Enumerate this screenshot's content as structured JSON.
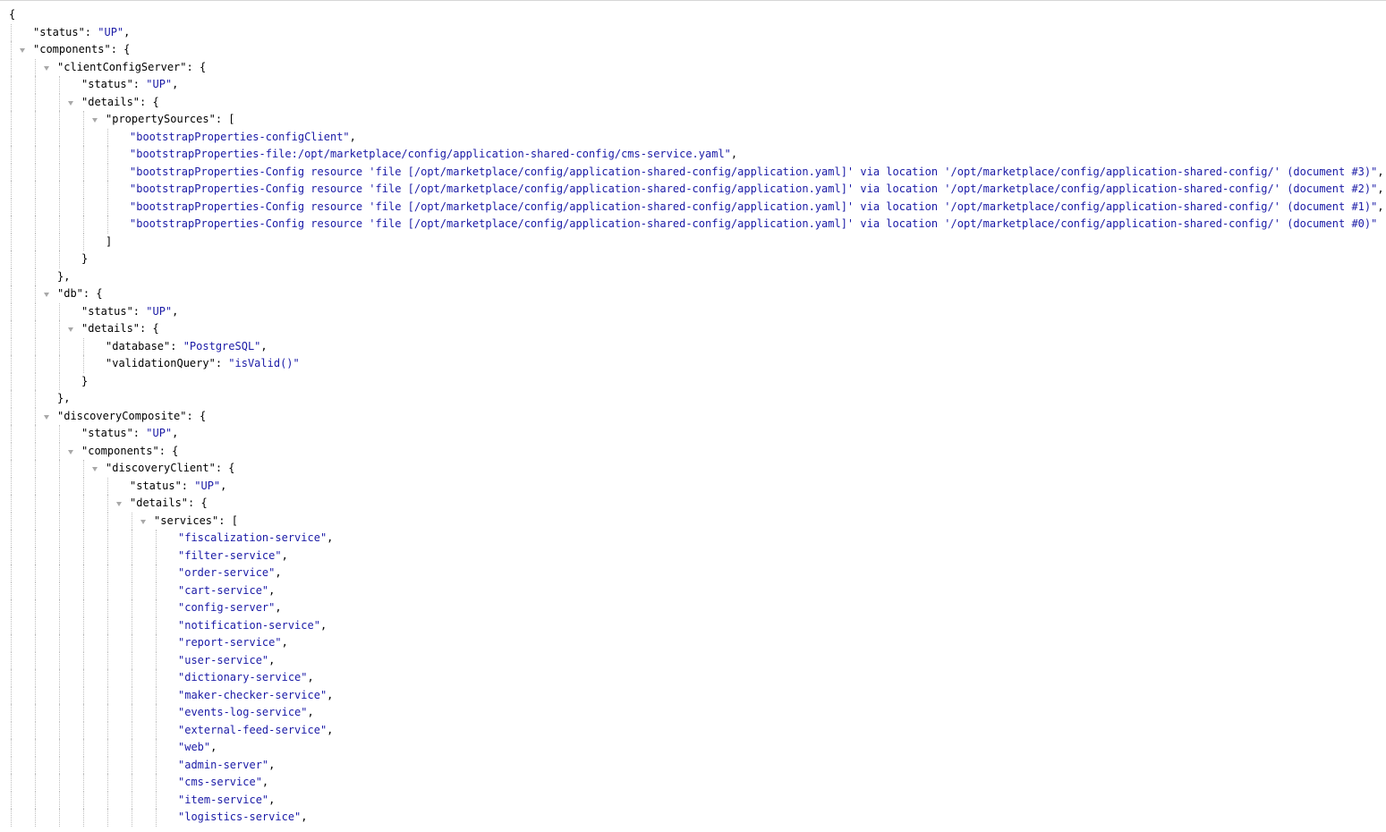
{
  "document": {
    "lines": [
      {
        "depth": 0,
        "toggle": false,
        "parts": [
          {
            "t": "{",
            "c": "punct"
          }
        ]
      },
      {
        "depth": 1,
        "toggle": false,
        "parts": [
          {
            "t": "\"status\"",
            "c": "key"
          },
          {
            "t": ": ",
            "c": "punct"
          },
          {
            "t": "\"UP\"",
            "c": "str"
          },
          {
            "t": ",",
            "c": "punct"
          }
        ]
      },
      {
        "depth": 1,
        "toggle": true,
        "parts": [
          {
            "t": "\"components\"",
            "c": "key"
          },
          {
            "t": ": {",
            "c": "punct"
          }
        ]
      },
      {
        "depth": 2,
        "toggle": true,
        "parts": [
          {
            "t": "\"clientConfigServer\"",
            "c": "key"
          },
          {
            "t": ": {",
            "c": "punct"
          }
        ]
      },
      {
        "depth": 3,
        "toggle": false,
        "parts": [
          {
            "t": "\"status\"",
            "c": "key"
          },
          {
            "t": ": ",
            "c": "punct"
          },
          {
            "t": "\"UP\"",
            "c": "str"
          },
          {
            "t": ",",
            "c": "punct"
          }
        ]
      },
      {
        "depth": 3,
        "toggle": true,
        "parts": [
          {
            "t": "\"details\"",
            "c": "key"
          },
          {
            "t": ": {",
            "c": "punct"
          }
        ]
      },
      {
        "depth": 4,
        "toggle": true,
        "parts": [
          {
            "t": "\"propertySources\"",
            "c": "key"
          },
          {
            "t": ": [",
            "c": "punct"
          }
        ]
      },
      {
        "depth": 5,
        "toggle": false,
        "parts": [
          {
            "t": "\"bootstrapProperties-configClient\"",
            "c": "str"
          },
          {
            "t": ",",
            "c": "punct"
          }
        ]
      },
      {
        "depth": 5,
        "toggle": false,
        "parts": [
          {
            "t": "\"bootstrapProperties-file:/opt/marketplace/config/application-shared-config/cms-service.yaml\"",
            "c": "str"
          },
          {
            "t": ",",
            "c": "punct"
          }
        ]
      },
      {
        "depth": 5,
        "toggle": false,
        "parts": [
          {
            "t": "\"bootstrapProperties-Config resource 'file [/opt/marketplace/config/application-shared-config/application.yaml]' via location '/opt/marketplace/config/application-shared-config/' (document #3)\"",
            "c": "str"
          },
          {
            "t": ",",
            "c": "punct"
          }
        ]
      },
      {
        "depth": 5,
        "toggle": false,
        "parts": [
          {
            "t": "\"bootstrapProperties-Config resource 'file [/opt/marketplace/config/application-shared-config/application.yaml]' via location '/opt/marketplace/config/application-shared-config/' (document #2)\"",
            "c": "str"
          },
          {
            "t": ",",
            "c": "punct"
          }
        ]
      },
      {
        "depth": 5,
        "toggle": false,
        "parts": [
          {
            "t": "\"bootstrapProperties-Config resource 'file [/opt/marketplace/config/application-shared-config/application.yaml]' via location '/opt/marketplace/config/application-shared-config/' (document #1)\"",
            "c": "str"
          },
          {
            "t": ",",
            "c": "punct"
          }
        ]
      },
      {
        "depth": 5,
        "toggle": false,
        "parts": [
          {
            "t": "\"bootstrapProperties-Config resource 'file [/opt/marketplace/config/application-shared-config/application.yaml]' via location '/opt/marketplace/config/application-shared-config/' (document #0)\"",
            "c": "str"
          }
        ]
      },
      {
        "depth": 4,
        "toggle": false,
        "parts": [
          {
            "t": "]",
            "c": "punct"
          }
        ]
      },
      {
        "depth": 3,
        "toggle": false,
        "parts": [
          {
            "t": "}",
            "c": "punct"
          }
        ]
      },
      {
        "depth": 2,
        "toggle": false,
        "parts": [
          {
            "t": "},",
            "c": "punct"
          }
        ]
      },
      {
        "depth": 2,
        "toggle": true,
        "parts": [
          {
            "t": "\"db\"",
            "c": "key"
          },
          {
            "t": ": {",
            "c": "punct"
          }
        ]
      },
      {
        "depth": 3,
        "toggle": false,
        "parts": [
          {
            "t": "\"status\"",
            "c": "key"
          },
          {
            "t": ": ",
            "c": "punct"
          },
          {
            "t": "\"UP\"",
            "c": "str"
          },
          {
            "t": ",",
            "c": "punct"
          }
        ]
      },
      {
        "depth": 3,
        "toggle": true,
        "parts": [
          {
            "t": "\"details\"",
            "c": "key"
          },
          {
            "t": ": {",
            "c": "punct"
          }
        ]
      },
      {
        "depth": 4,
        "toggle": false,
        "parts": [
          {
            "t": "\"database\"",
            "c": "key"
          },
          {
            "t": ": ",
            "c": "punct"
          },
          {
            "t": "\"PostgreSQL\"",
            "c": "str"
          },
          {
            "t": ",",
            "c": "punct"
          }
        ]
      },
      {
        "depth": 4,
        "toggle": false,
        "parts": [
          {
            "t": "\"validationQuery\"",
            "c": "key"
          },
          {
            "t": ": ",
            "c": "punct"
          },
          {
            "t": "\"isValid()\"",
            "c": "str"
          }
        ]
      },
      {
        "depth": 3,
        "toggle": false,
        "parts": [
          {
            "t": "}",
            "c": "punct"
          }
        ]
      },
      {
        "depth": 2,
        "toggle": false,
        "parts": [
          {
            "t": "},",
            "c": "punct"
          }
        ]
      },
      {
        "depth": 2,
        "toggle": true,
        "parts": [
          {
            "t": "\"discoveryComposite\"",
            "c": "key"
          },
          {
            "t": ": {",
            "c": "punct"
          }
        ]
      },
      {
        "depth": 3,
        "toggle": false,
        "parts": [
          {
            "t": "\"status\"",
            "c": "key"
          },
          {
            "t": ": ",
            "c": "punct"
          },
          {
            "t": "\"UP\"",
            "c": "str"
          },
          {
            "t": ",",
            "c": "punct"
          }
        ]
      },
      {
        "depth": 3,
        "toggle": true,
        "parts": [
          {
            "t": "\"components\"",
            "c": "key"
          },
          {
            "t": ": {",
            "c": "punct"
          }
        ]
      },
      {
        "depth": 4,
        "toggle": true,
        "parts": [
          {
            "t": "\"discoveryClient\"",
            "c": "key"
          },
          {
            "t": ": {",
            "c": "punct"
          }
        ]
      },
      {
        "depth": 5,
        "toggle": false,
        "parts": [
          {
            "t": "\"status\"",
            "c": "key"
          },
          {
            "t": ": ",
            "c": "punct"
          },
          {
            "t": "\"UP\"",
            "c": "str"
          },
          {
            "t": ",",
            "c": "punct"
          }
        ]
      },
      {
        "depth": 5,
        "toggle": true,
        "parts": [
          {
            "t": "\"details\"",
            "c": "key"
          },
          {
            "t": ": {",
            "c": "punct"
          }
        ]
      },
      {
        "depth": 6,
        "toggle": true,
        "parts": [
          {
            "t": "\"services\"",
            "c": "key"
          },
          {
            "t": ": [",
            "c": "punct"
          }
        ]
      },
      {
        "depth": 7,
        "toggle": false,
        "parts": [
          {
            "t": "\"fiscalization-service\"",
            "c": "str"
          },
          {
            "t": ",",
            "c": "punct"
          }
        ]
      },
      {
        "depth": 7,
        "toggle": false,
        "parts": [
          {
            "t": "\"filter-service\"",
            "c": "str"
          },
          {
            "t": ",",
            "c": "punct"
          }
        ]
      },
      {
        "depth": 7,
        "toggle": false,
        "parts": [
          {
            "t": "\"order-service\"",
            "c": "str"
          },
          {
            "t": ",",
            "c": "punct"
          }
        ]
      },
      {
        "depth": 7,
        "toggle": false,
        "parts": [
          {
            "t": "\"cart-service\"",
            "c": "str"
          },
          {
            "t": ",",
            "c": "punct"
          }
        ]
      },
      {
        "depth": 7,
        "toggle": false,
        "parts": [
          {
            "t": "\"config-server\"",
            "c": "str"
          },
          {
            "t": ",",
            "c": "punct"
          }
        ]
      },
      {
        "depth": 7,
        "toggle": false,
        "parts": [
          {
            "t": "\"notification-service\"",
            "c": "str"
          },
          {
            "t": ",",
            "c": "punct"
          }
        ]
      },
      {
        "depth": 7,
        "toggle": false,
        "parts": [
          {
            "t": "\"report-service\"",
            "c": "str"
          },
          {
            "t": ",",
            "c": "punct"
          }
        ]
      },
      {
        "depth": 7,
        "toggle": false,
        "parts": [
          {
            "t": "\"user-service\"",
            "c": "str"
          },
          {
            "t": ",",
            "c": "punct"
          }
        ]
      },
      {
        "depth": 7,
        "toggle": false,
        "parts": [
          {
            "t": "\"dictionary-service\"",
            "c": "str"
          },
          {
            "t": ",",
            "c": "punct"
          }
        ]
      },
      {
        "depth": 7,
        "toggle": false,
        "parts": [
          {
            "t": "\"maker-checker-service\"",
            "c": "str"
          },
          {
            "t": ",",
            "c": "punct"
          }
        ]
      },
      {
        "depth": 7,
        "toggle": false,
        "parts": [
          {
            "t": "\"events-log-service\"",
            "c": "str"
          },
          {
            "t": ",",
            "c": "punct"
          }
        ]
      },
      {
        "depth": 7,
        "toggle": false,
        "parts": [
          {
            "t": "\"external-feed-service\"",
            "c": "str"
          },
          {
            "t": ",",
            "c": "punct"
          }
        ]
      },
      {
        "depth": 7,
        "toggle": false,
        "parts": [
          {
            "t": "\"web\"",
            "c": "str"
          },
          {
            "t": ",",
            "c": "punct"
          }
        ]
      },
      {
        "depth": 7,
        "toggle": false,
        "parts": [
          {
            "t": "\"admin-server\"",
            "c": "str"
          },
          {
            "t": ",",
            "c": "punct"
          }
        ]
      },
      {
        "depth": 7,
        "toggle": false,
        "parts": [
          {
            "t": "\"cms-service\"",
            "c": "str"
          },
          {
            "t": ",",
            "c": "punct"
          }
        ]
      },
      {
        "depth": 7,
        "toggle": false,
        "parts": [
          {
            "t": "\"item-service\"",
            "c": "str"
          },
          {
            "t": ",",
            "c": "punct"
          }
        ]
      },
      {
        "depth": 7,
        "toggle": false,
        "parts": [
          {
            "t": "\"logistics-service\"",
            "c": "str"
          },
          {
            "t": ",",
            "c": "punct"
          }
        ]
      }
    ]
  }
}
